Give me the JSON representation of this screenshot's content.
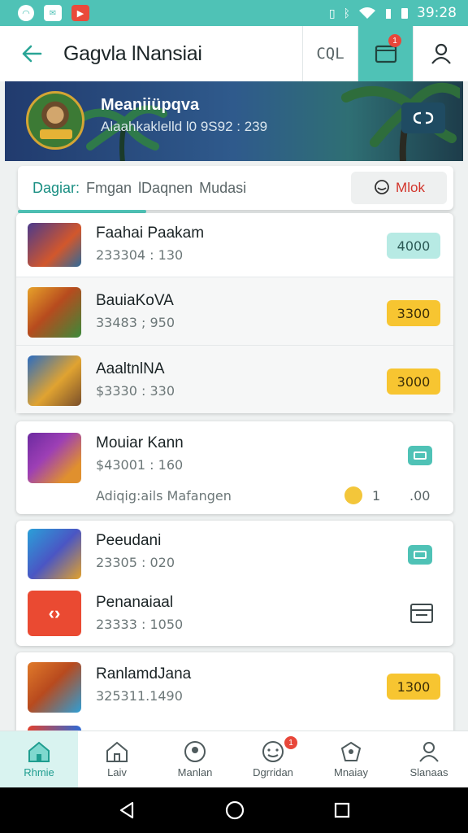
{
  "status_bar": {
    "time": "39:28",
    "icons": [
      "notification-circle-icon",
      "mail-icon",
      "play-store-icon",
      "vibrate-icon",
      "bluetooth-icon",
      "wifi-icon",
      "signal-icon",
      "battery-icon"
    ]
  },
  "header": {
    "title": "Gagvla lNansiai",
    "code_label": "CQL",
    "badge": "1"
  },
  "banner": {
    "name": "Meaniiüpqva",
    "subtitle": "Alaahkaklelld l0 9S92 : 239"
  },
  "tabs": {
    "items": [
      "Dagiar:",
      "Fmgan",
      "lDaqnen",
      "Mudasi"
    ],
    "active": 0,
    "action_label": "Mlok"
  },
  "list": {
    "group1": [
      {
        "title": "Faahai  Paakam",
        "sub": "233304 : 130",
        "price": "4000",
        "price_style": "teal"
      },
      {
        "title": "BauiaKoVA",
        "sub": "33483 ; 950",
        "price": "3300",
        "price_style": "yellow"
      },
      {
        "title": "AaaltnlNA",
        "sub": "$3330 : 330",
        "price": "3000",
        "price_style": "yellow"
      }
    ],
    "group2": {
      "title": "Mouiar  Kann",
      "sub": "$43001 : 160",
      "note": "Adiqig:ails Mafangen",
      "stat_a": "1",
      "stat_b": ".00"
    },
    "group3": [
      {
        "title": "Peeudani",
        "sub": "23305 : 020"
      },
      {
        "title": "Penanaiaal",
        "sub": "23333 : 1050"
      }
    ],
    "group4": [
      {
        "title": "RanlamdJana",
        "sub": "325311.1490",
        "price": "1300",
        "price_style": "yellow"
      }
    ]
  },
  "bottom_nav": {
    "items": [
      "Rhmie",
      "Laiv",
      "Manlan",
      "Dgrridan",
      "Mnaiay",
      "Slanaas"
    ],
    "active": 0,
    "badge": "1"
  },
  "colors": {
    "accent": "#4fc2b6",
    "badge": "#e8473a",
    "price_yellow": "#f7c531",
    "price_teal": "#b7eae4"
  }
}
